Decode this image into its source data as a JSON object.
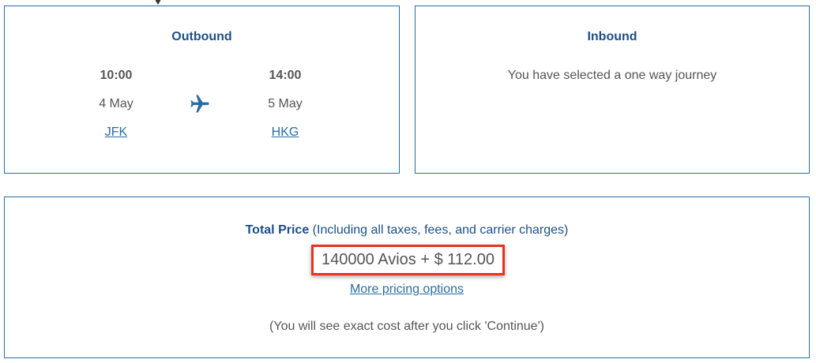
{
  "outbound": {
    "title": "Outbound",
    "departure": {
      "time": "10:00",
      "date": "4 May",
      "airport": "JFK"
    },
    "arrival": {
      "time": "14:00",
      "date": "5 May",
      "airport": "HKG"
    },
    "icon": "plane-icon"
  },
  "inbound": {
    "title": "Inbound",
    "message": "You have selected a one way journey"
  },
  "price": {
    "label": "Total Price",
    "label_note": "(Including all taxes, fees, and carrier charges)",
    "amount": "140000 Avios + $ 112.00",
    "more_options": "More pricing options",
    "note": "(You will see exact cost after you click 'Continue')"
  },
  "colors": {
    "accent": "#2b6ca3",
    "heading": "#1d4f86",
    "highlight": "#e8321e"
  }
}
